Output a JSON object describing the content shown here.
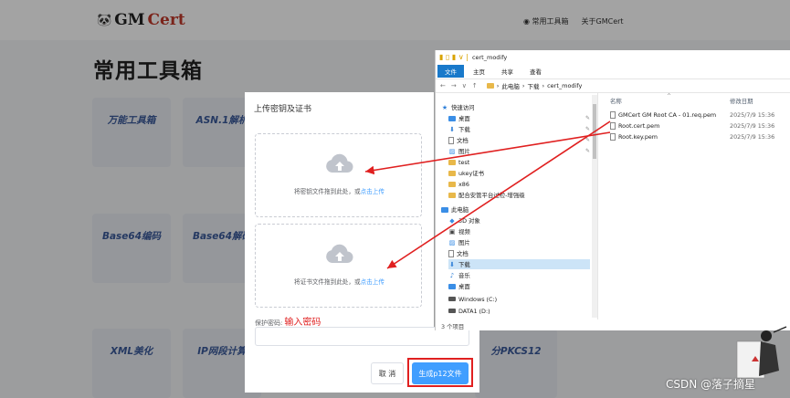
{
  "site": {
    "logo": {
      "prefix": "GM",
      "suffix": "Cert"
    },
    "nav": {
      "home": "常用工具箱",
      "about": "关于GMCert"
    },
    "page_title": "常用工具箱",
    "tool_cards": [
      "万能工具箱",
      "ASN.1解析",
      "Base64编码",
      "Base64解码",
      "XML美化",
      "IP网段计算",
      "分PKCS12"
    ]
  },
  "dialog": {
    "title": "上传密钥及证书",
    "upload_key": {
      "text": "将密钥文件拖到此处，或",
      "link": "点击上传"
    },
    "upload_cert": {
      "text": "将证书文件拖到此处，或",
      "link": "点击上传"
    },
    "password_label": "保护密码:",
    "password_hint": "输入密码",
    "password_value": "",
    "cancel_label": "取 消",
    "generate_label": "生成p12文件"
  },
  "explorer": {
    "window_title": "cert_modify",
    "ribbon_tabs": [
      "文件",
      "主页",
      "共享",
      "查看"
    ],
    "breadcrumb": [
      "此电脑",
      "下载",
      "cert_modify"
    ],
    "nav_items": [
      {
        "label": "快速访问",
        "icon": "star-icon"
      },
      {
        "label": "桌面",
        "icon": "desktop-icon"
      },
      {
        "label": "下载",
        "icon": "download-icon"
      },
      {
        "label": "文档",
        "icon": "document-icon"
      },
      {
        "label": "图片",
        "icon": "picture-icon"
      },
      {
        "label": "test",
        "icon": "folder-icon"
      },
      {
        "label": "ukey证书",
        "icon": "folder-icon"
      },
      {
        "label": "x86",
        "icon": "folder-icon"
      },
      {
        "label": "配合安管平台过检-增强级",
        "icon": "folder-icon"
      },
      {
        "label": "此电脑",
        "icon": "computer-icon"
      },
      {
        "label": "3D 对象",
        "icon": "cube-icon"
      },
      {
        "label": "视频",
        "icon": "video-icon"
      },
      {
        "label": "图片",
        "icon": "picture-icon"
      },
      {
        "label": "文档",
        "icon": "document-icon"
      },
      {
        "label": "下载",
        "icon": "download-icon"
      },
      {
        "label": "音乐",
        "icon": "music-icon"
      },
      {
        "label": "桌面",
        "icon": "desktop-icon"
      },
      {
        "label": "Windows (C:)",
        "icon": "drive-icon"
      },
      {
        "label": "DATA1 (D:)",
        "icon": "drive-icon"
      }
    ],
    "columns": {
      "name": "名称",
      "date": "修改日期"
    },
    "files": [
      {
        "name": "GMCert GM Root CA - 01.req.pem",
        "date": "2025/7/9 15:36"
      },
      {
        "name": "Root.cert.pem",
        "date": "2025/7/9 15:36"
      },
      {
        "name": "Root.key.pem",
        "date": "2025/7/9 15:36"
      }
    ],
    "status": "3 个项目"
  },
  "watermark": "CSDN @落子摘星"
}
